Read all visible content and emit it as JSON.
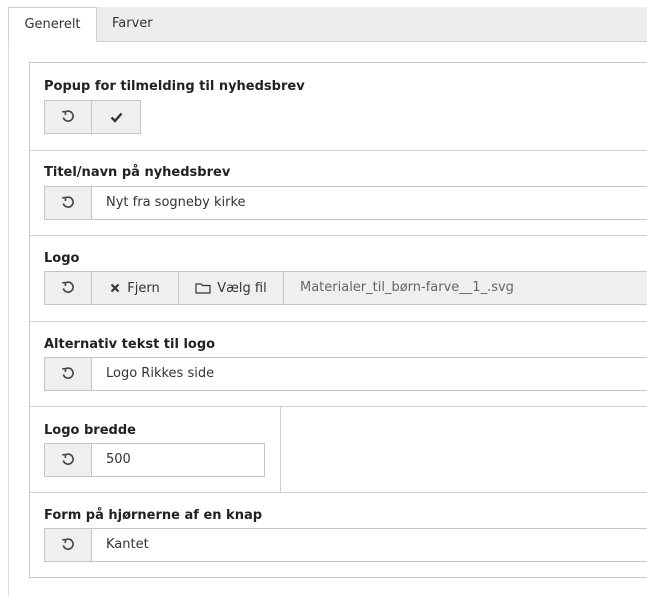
{
  "tabs": [
    {
      "label": "Generelt",
      "active": true
    },
    {
      "label": "Farver",
      "active": false
    }
  ],
  "fields": {
    "popup": {
      "label": "Popup for tilmelding til nyhedsbrev",
      "checked": true
    },
    "title": {
      "label": "Titel/navn på nyhedsbrev",
      "value": "Nyt fra sogneby kirke"
    },
    "logo": {
      "label": "Logo",
      "remove_label": "Fjern",
      "choose_label": "Vælg fil",
      "filename": "Materialer_til_børn-farve__1_.svg"
    },
    "alt_text": {
      "label": "Alternativ tekst til logo",
      "value": "Logo Rikkes side"
    },
    "logo_width": {
      "label": "Logo bredde",
      "value": "500"
    },
    "button_shape": {
      "label": "Form på hjørnerne af en knap",
      "value": "Kantet"
    }
  },
  "icons": {
    "reset": "undo-icon",
    "check": "checkmark-icon",
    "remove": "close-icon",
    "folder": "folder-icon"
  }
}
